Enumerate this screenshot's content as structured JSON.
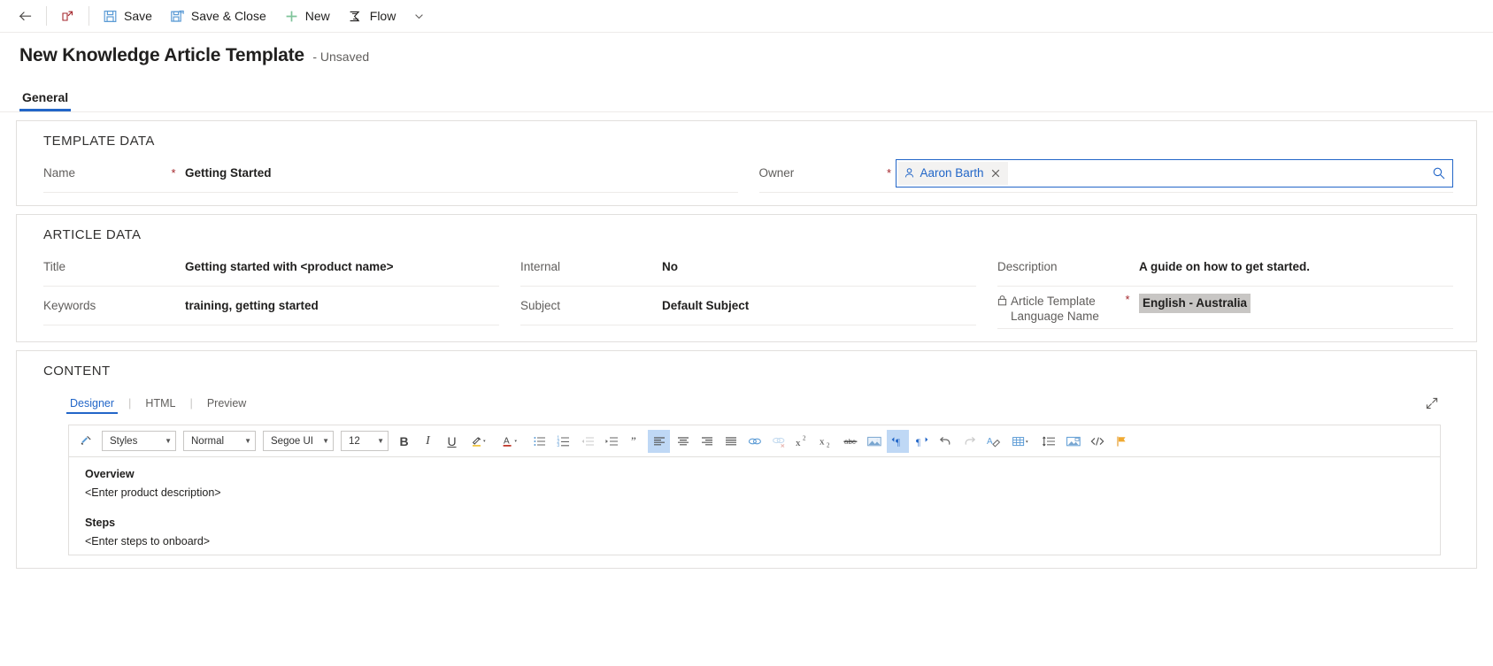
{
  "commandbar": {
    "back": {
      "icon": "back-arrow-icon",
      "label": ""
    },
    "popout": {
      "icon": "open-in-new-window-icon",
      "label": ""
    },
    "save": {
      "icon": "save-icon",
      "label": "Save"
    },
    "save_close": {
      "icon": "save-and-close-icon",
      "label": "Save & Close"
    },
    "new": {
      "icon": "plus-icon",
      "label": "New"
    },
    "flow": {
      "icon": "flow-icon",
      "label": "Flow"
    },
    "flow_chevron": {
      "icon": "chevron-down-icon",
      "label": ""
    }
  },
  "header": {
    "title": "New Knowledge Article Template",
    "subtitle": "- Unsaved"
  },
  "tabs": [
    {
      "label": "General",
      "active": true
    }
  ],
  "sections": {
    "template_data": {
      "title": "TEMPLATE DATA",
      "fields": [
        {
          "label": "Name",
          "required": true,
          "value": "Getting Started"
        }
      ],
      "owner": {
        "label": "Owner",
        "required": true,
        "pill_icon": "person-icon",
        "pill_name": "Aaron Barth",
        "remove_icon": "close-icon",
        "search_icon": "search-icon"
      }
    },
    "article_data": {
      "title": "ARTICLE DATA",
      "column1": [
        {
          "label": "Title",
          "required": false,
          "value": "Getting started with <product name>"
        },
        {
          "label": "Keywords",
          "required": false,
          "value": "training, getting started"
        }
      ],
      "column2": [
        {
          "label": "Internal",
          "required": false,
          "value": "No"
        },
        {
          "label": "Subject",
          "required": false,
          "value": "Default Subject"
        }
      ],
      "column3": [
        {
          "label": "Description",
          "required": false,
          "value": "A guide on how to get started."
        },
        {
          "label": "Article Template Language Name",
          "label_line1": "Article Template",
          "label_line2": "Language Name",
          "required": true,
          "locked": true,
          "lock_icon": "lock-icon",
          "value": "English - Australia",
          "highlighted": true
        }
      ]
    },
    "content": {
      "title": "CONTENT",
      "editor_tabs": [
        {
          "label": "Designer",
          "active": true
        },
        {
          "label": "HTML",
          "active": false
        },
        {
          "label": "Preview",
          "active": false
        }
      ],
      "tab_divider": "|",
      "expand_icon": "expand-diagonal-icon",
      "toolbar": {
        "format_painter_icon": "format-painter-icon",
        "styles_select": "Styles",
        "paragraph_select": "Normal",
        "font_select": "Segoe UI",
        "size_select": "12",
        "bold": "B",
        "italic": "I",
        "underline": "U",
        "highlight_icon": "text-highlight-icon",
        "fontcolor_icon": "font-color-icon",
        "bullet_list_icon": "bulleted-list-icon",
        "numbered_list_icon": "numbered-list-icon",
        "outdent_icon": "decrease-indent-icon",
        "indent_icon": "increase-indent-icon",
        "blockquote_icon": "block-quote-icon",
        "align_left_icon": "align-left-icon",
        "align_center_icon": "align-center-icon",
        "align_right_icon": "align-right-icon",
        "align_justify_icon": "align-justify-icon",
        "link_icon": "insert-link-icon",
        "unlink_icon": "remove-link-icon",
        "superscript_icon": "superscript-icon",
        "subscript_icon": "subscript-icon",
        "strikethrough_icon": "strikethrough-icon",
        "image_icon": "insert-image-icon",
        "ltr_icon": "left-to-right-icon",
        "rtl_icon": "right-to-left-icon",
        "undo_icon": "undo-icon",
        "redo_icon": "redo-icon",
        "clearformat_icon": "clear-formatting-icon",
        "table_icon": "insert-table-icon",
        "linespacing_icon": "line-spacing-icon",
        "insertimage2_icon": "insert-picture-icon",
        "codeview_icon": "code-view-icon",
        "flag_icon": "flag-icon"
      },
      "body": [
        {
          "type": "heading",
          "text": "Overview"
        },
        {
          "type": "paragraph",
          "text": "<Enter product description>"
        },
        {
          "type": "heading",
          "text": "Steps"
        },
        {
          "type": "paragraph",
          "text": "<Enter steps to onboard>"
        }
      ]
    }
  },
  "colors": {
    "accent": "#2266c8",
    "required": "#a4262c",
    "save_icon": "#5b9bd5",
    "new_icon": "#7fc49a",
    "highlight_bg": "#c8c6c4",
    "toolbar_active": "#bfd8f5"
  }
}
